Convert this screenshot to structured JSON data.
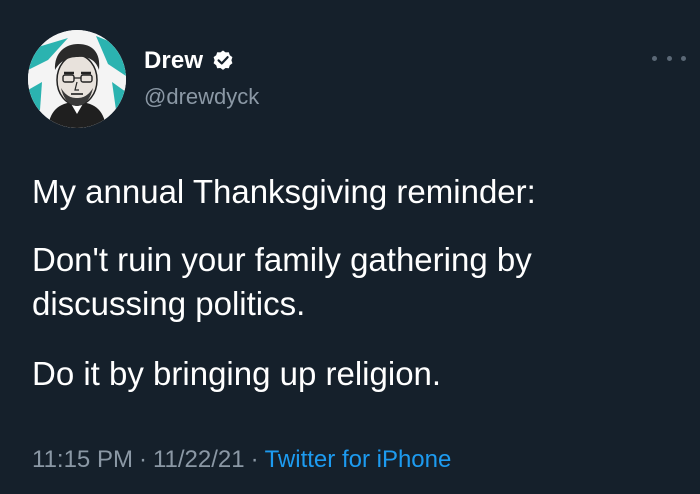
{
  "author": {
    "name": "Drew",
    "handle": "@drewdyck",
    "verified": true
  },
  "icons": {
    "verified": "verified-badge-icon",
    "more": "more-options-icon"
  },
  "tweet": {
    "paragraphs": [
      "My annual Thanksgiving reminder:",
      "Don't ruin your family gathering by discussing politics.",
      "Do it by bringing up religion."
    ]
  },
  "meta": {
    "time": "11:15 PM",
    "separator": "·",
    "date": "11/22/21",
    "source": "Twitter for iPhone"
  },
  "colors": {
    "background": "#15202b",
    "text": "#ffffff",
    "secondary_text": "#8b98a5",
    "link": "#1d9bf0",
    "avatar_accent": "#2bb3b0"
  }
}
